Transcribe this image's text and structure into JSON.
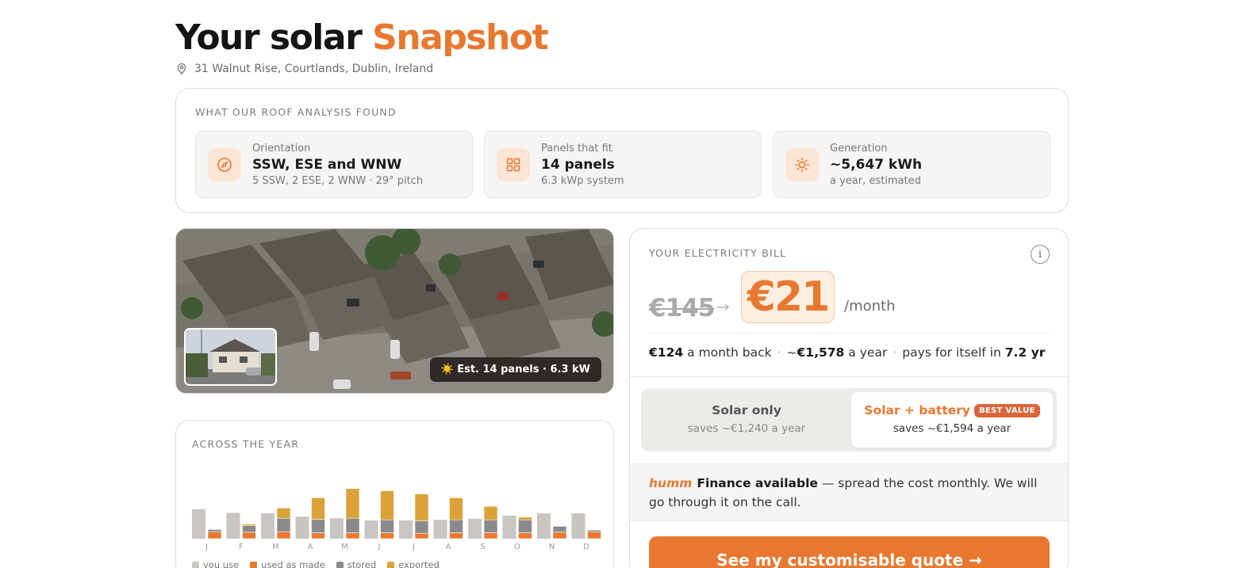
{
  "header": {
    "title_plain": "Your solar",
    "title_accent": "Snapshot",
    "address": "31 Walnut Rise, Courtlands, Dublin, Ireland",
    "accent_color": "#e8782f"
  },
  "roof_analysis": {
    "label": "WHAT OUR ROOF ANALYSIS FOUND",
    "tiles": [
      {
        "icon": "compass-icon",
        "label": "Orientation",
        "value": "SSW, ESE and WNW",
        "sub": "5 SSW, 2 ESE, 2 WNW · 29° pitch"
      },
      {
        "icon": "grid-icon",
        "label": "Panels that fit",
        "value": "14 panels",
        "sub": "6.3 kWp system"
      },
      {
        "icon": "sun-icon",
        "label": "Generation",
        "value": "~5,647 kWh",
        "sub": "a year, estimated"
      }
    ]
  },
  "aerial": {
    "estimate": "☀️ Est. 14 panels · 6.3 kW"
  },
  "year": {
    "label": "ACROSS THE YEAR",
    "legend": [
      "you use",
      "used as made",
      "stored",
      "exported"
    ]
  },
  "chart_data": {
    "type": "bar",
    "categories": [
      "J",
      "F",
      "M",
      "A",
      "M",
      "J",
      "J",
      "A",
      "S",
      "O",
      "N",
      "D"
    ],
    "series": [
      {
        "name": "you use",
        "values": [
          55,
          48,
          47,
          41,
          38,
          34,
          34,
          35,
          37,
          43,
          47,
          47
        ]
      },
      {
        "name": "used as made",
        "values": [
          13,
          12,
          13,
          11,
          11,
          11,
          10,
          11,
          11,
          11,
          12,
          13
        ]
      },
      {
        "name": "stored",
        "values": [
          4,
          12,
          25,
          25,
          27,
          24,
          23,
          24,
          24,
          24,
          11,
          3
        ]
      },
      {
        "name": "exported",
        "values": [
          0,
          3,
          19,
          40,
          55,
          54,
          50,
          41,
          25,
          5,
          0,
          0
        ]
      }
    ],
    "colors": [
      "#c9c6c1",
      "#e8782f",
      "#8a8a8a",
      "#dba23a"
    ]
  },
  "bill": {
    "label": "YOUR ELECTRICITY BILL",
    "info": "i",
    "old_price": "€145",
    "arrow": "→",
    "new_price": "€21",
    "per": "/month",
    "monthly_back": "€124",
    "monthly_back_text": "a month back",
    "yearly_prefix": "~",
    "yearly": "€1,578",
    "yearly_text": "a year",
    "payback_text": "pays for itself in",
    "payback": "7.2 yr",
    "options": [
      {
        "title": "Solar only",
        "sub": "saves ~€1,240 a year"
      },
      {
        "title": "Solar + battery",
        "badge": "BEST VALUE",
        "sub": "saves ~€1,594 a year"
      }
    ],
    "finance_brand": "humm",
    "finance_bold": "Finance available",
    "finance_rest": "— spread the cost monthly. We will go through it on the call.",
    "cta": "See my customisable quote →"
  }
}
